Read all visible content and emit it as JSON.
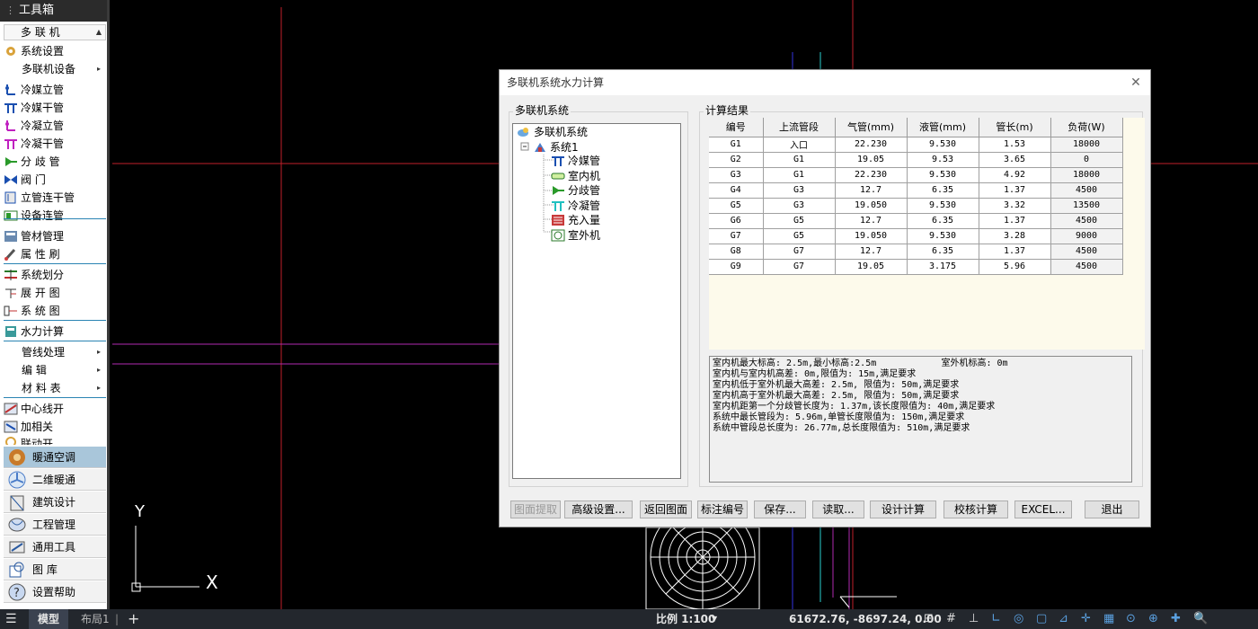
{
  "toolbox": {
    "title": "工具箱",
    "dropdown": "多 联 机",
    "items": [
      {
        "label": "系统设置",
        "icon": "gear-icon"
      },
      {
        "label": "多联机设备",
        "icon": "",
        "submenu": true
      },
      {
        "label": "冷媒立管",
        "icon": "riser-icon"
      },
      {
        "label": "冷媒干管",
        "icon": "main-pipe-icon"
      },
      {
        "label": "冷凝立管",
        "icon": "condensate-riser-icon"
      },
      {
        "label": "冷凝干管",
        "icon": "condensate-main-icon"
      },
      {
        "label": "分 歧 管",
        "icon": "branch-icon"
      },
      {
        "label": "阀      门",
        "icon": "valve-icon"
      },
      {
        "label": "立管连干管",
        "icon": "connect-icon"
      },
      {
        "label": "设备连管",
        "icon": "device-connect-icon"
      },
      {
        "label": "管材管理",
        "icon": "pipe-material-icon"
      },
      {
        "label": "属 性 刷",
        "icon": "brush-icon"
      },
      {
        "label": "系统划分",
        "icon": "divide-icon"
      },
      {
        "label": "展 开 图",
        "icon": "expand-icon"
      },
      {
        "label": "系 统 图",
        "icon": "system-diagram-icon"
      },
      {
        "label": "水力计算",
        "icon": "calc-icon"
      },
      {
        "label": "管线处理",
        "icon": "",
        "submenu": true
      },
      {
        "label": "编    辑",
        "icon": "",
        "submenu": true
      },
      {
        "label": "材 料 表",
        "icon": "",
        "submenu": true
      },
      {
        "label": "中心线开",
        "icon": "centerline-icon"
      },
      {
        "label": "加相关",
        "icon": "relate-icon"
      },
      {
        "label": "联动开",
        "icon": "link-icon"
      }
    ],
    "bottom_buttons": [
      {
        "label": "暖通空调",
        "icon": "hvac-icon",
        "active": true
      },
      {
        "label": "二维暖通",
        "icon": "fan-icon",
        "active": false
      },
      {
        "label": "建筑设计",
        "icon": "building-icon",
        "active": false
      },
      {
        "label": "工程管理",
        "icon": "project-icon",
        "active": false
      },
      {
        "label": "通用工具",
        "icon": "tools-icon",
        "active": false
      },
      {
        "label": "图      库",
        "icon": "library-icon",
        "active": false
      },
      {
        "label": "设置帮助",
        "icon": "help-icon",
        "active": false
      }
    ]
  },
  "canvas": {
    "axis_y": "Y",
    "axis_x": "X"
  },
  "dialog": {
    "title": "多联机系统水力计算",
    "tree_group_label": "多联机系统",
    "tree": {
      "root": "多联机系统",
      "system": "系统1",
      "children": [
        {
          "label": "冷媒管",
          "icon": "refrigerant-pipe-icon"
        },
        {
          "label": "室内机",
          "icon": "indoor-unit-icon"
        },
        {
          "label": "分歧管",
          "icon": "branch-pipe-icon"
        },
        {
          "label": "冷凝管",
          "icon": "condensate-pipe-icon"
        },
        {
          "label": "充入量",
          "icon": "charge-icon"
        },
        {
          "label": "室外机",
          "icon": "outdoor-unit-icon"
        }
      ]
    },
    "results_group_label": "计算结果",
    "table": {
      "headers": [
        "编号",
        "上流管段",
        "气管(mm)",
        "液管(mm)",
        "管长(m)",
        "负荷(W)"
      ],
      "rows": [
        [
          "G1",
          "入口",
          "22.230",
          "9.530",
          "1.53",
          "18000"
        ],
        [
          "G2",
          "G1",
          "19.05",
          "9.53",
          "3.65",
          "0"
        ],
        [
          "G3",
          "G1",
          "22.230",
          "9.530",
          "4.92",
          "18000"
        ],
        [
          "G4",
          "G3",
          "12.7",
          "6.35",
          "1.37",
          "4500"
        ],
        [
          "G5",
          "G3",
          "19.050",
          "9.530",
          "3.32",
          "13500"
        ],
        [
          "G6",
          "G5",
          "12.7",
          "6.35",
          "1.37",
          "4500"
        ],
        [
          "G7",
          "G5",
          "19.050",
          "9.530",
          "3.28",
          "9000"
        ],
        [
          "G8",
          "G7",
          "12.7",
          "6.35",
          "1.37",
          "4500"
        ],
        [
          "G9",
          "G7",
          "19.05",
          "3.175",
          "5.96",
          "4500"
        ]
      ]
    },
    "report_lines": [
      "室内机最大标高: 2.5m,最小标高:2.5m            室外机标高: 0m",
      "室内机与室内机高差: 0m,限值为: 15m,满足要求",
      "室内机低于室外机最大高差: 2.5m, 限值为: 50m,满足要求",
      "室内机高于室外机最大高差: 2.5m, 限值为: 50m,满足要求",
      "室内机距第一个分歧管长度为: 1.37m,该长度限值为: 40m,满足要求",
      "系统中最长管段为: 5.96m,单管长度限值为: 150m,满足要求",
      "系统中管段总长度为: 26.77m,总长度限值为: 510m,满足要求"
    ],
    "buttons": {
      "extract": "图面提取",
      "advanced": "高级设置...",
      "back": "返回图面",
      "label_number": "标注编号",
      "save": "保存...",
      "read": "读取...",
      "design_calc": "设计计算",
      "check_calc": "校核计算",
      "excel": "EXCEL...",
      "exit": "退出"
    }
  },
  "statusbar": {
    "tab_model": "模型",
    "tab_layout": "布局1",
    "add_tab": "+",
    "scale": "比例 1:100",
    "coords": "61672.76, -8697.24, 0.00"
  }
}
